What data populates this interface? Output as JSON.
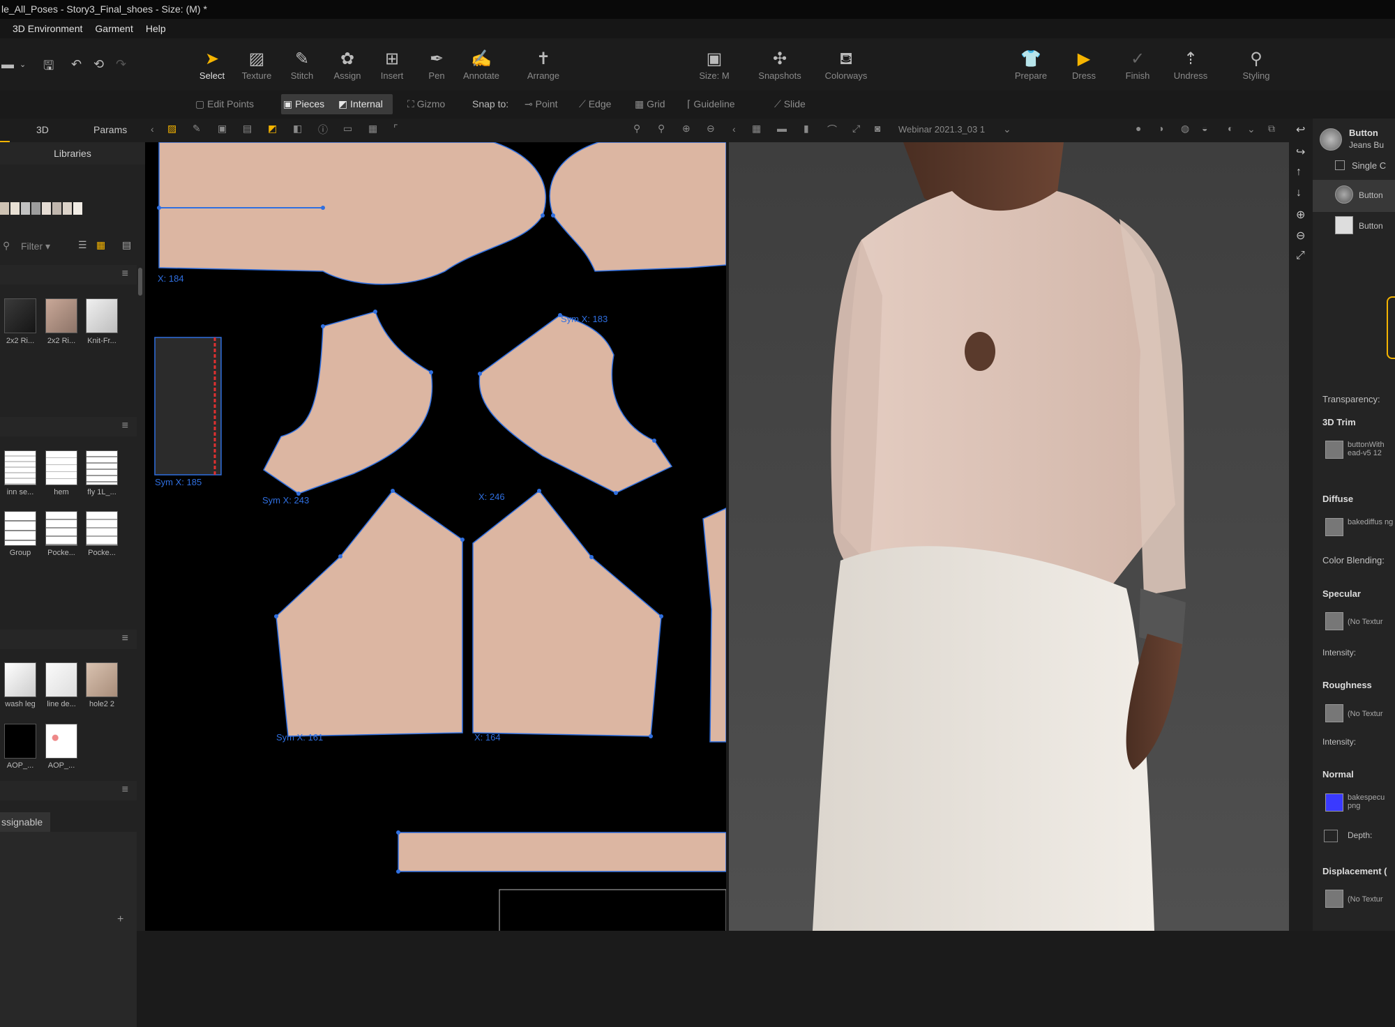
{
  "window": {
    "title": "le_All_Poses - Story3_Final_shoes - Size: (M) *"
  },
  "menu": [
    "3D Environment",
    "Garment",
    "Help"
  ],
  "toolbar": {
    "tools": [
      {
        "label": "Select",
        "icon": "arrow-select-icon",
        "glyph": "➤",
        "active": true
      },
      {
        "label": "Texture",
        "icon": "texture-icon",
        "glyph": "▨"
      },
      {
        "label": "Stitch",
        "icon": "stitch-icon",
        "glyph": "✎"
      },
      {
        "label": "Assign",
        "icon": "assign-icon",
        "glyph": "✿"
      },
      {
        "label": "Insert",
        "icon": "insert-icon",
        "glyph": "⊞"
      },
      {
        "label": "Pen",
        "icon": "pen-icon",
        "glyph": "✒"
      },
      {
        "label": "Annotate",
        "icon": "annotate-icon",
        "glyph": "✍"
      },
      {
        "label": "Arrange",
        "icon": "arrange-icon",
        "glyph": "✝"
      }
    ],
    "mid_tools": [
      {
        "label": "Size: M",
        "icon": "size-icon",
        "glyph": "▣"
      },
      {
        "label": "Snapshots",
        "icon": "snapshots-icon",
        "glyph": "✣"
      },
      {
        "label": "Colorways",
        "icon": "colorways-icon",
        "glyph": "⛾"
      }
    ],
    "right_tools": [
      {
        "label": "Prepare",
        "icon": "shirt-icon",
        "glyph": "👕"
      },
      {
        "label": "Dress",
        "icon": "play-icon",
        "glyph": "▶",
        "highlight": true
      },
      {
        "label": "Finish",
        "icon": "check-icon",
        "glyph": "✓"
      },
      {
        "label": "Undress",
        "icon": "undress-icon",
        "glyph": "⇡"
      },
      {
        "label": "Styling",
        "icon": "wand-icon",
        "glyph": "⚲"
      }
    ]
  },
  "subtoolbar": {
    "edit_points": "Edit Points",
    "pieces": "Pieces",
    "internal": "Internal",
    "gizmo": "Gizmo",
    "snap_to": "Snap to:",
    "point": "Point",
    "edge": "Edge",
    "grid": "Grid",
    "guideline": "Guideline",
    "slide": "Slide"
  },
  "sidebar": {
    "tabs": [
      "3D",
      "Params"
    ],
    "libraries": "Libraries",
    "filter": "Filter",
    "group1": [
      "2x2 Ri...",
      "2x2 Ri...",
      "Knit-Fr..."
    ],
    "group2": [
      "inn se...",
      "hem",
      "fly 1L_...",
      "Group",
      "Pocke...",
      "Pocke..."
    ],
    "group3": [
      "wash leg",
      "line de...",
      "hole2 2",
      "AOP_...",
      "AOP_..."
    ],
    "assignable": "ssignable",
    "add": "+"
  },
  "canvas2d": {
    "labels": [
      "X: 184",
      "Sym X: 183",
      "Sym X: 185",
      "Sym X: 243",
      "X: 246",
      "Sym X: 161",
      "X: 164"
    ],
    "piece_color": "#dcb6a2",
    "line_color": "#2f6fe0"
  },
  "viewbar": {
    "camera": "Webinar 2021.3_03 1"
  },
  "right_panel": {
    "header_title": "Button",
    "header_sub": "Jeans Bu",
    "single": "Single C",
    "item1": "Button",
    "item2": "Button",
    "transparency": "Transparency:",
    "trim_3d": "3D Trim",
    "trim_file": "buttonWith ead-v5 12",
    "diffuse": "Diffuse",
    "diffuse_file": "bakediffus ng",
    "color_blending": "Color Blending:",
    "specular": "Specular",
    "no_texture": "(No Textur",
    "intensity": "Intensity:",
    "roughness": "Roughness",
    "normal": "Normal",
    "normal_file": "bakespecu png",
    "depth": "Depth:",
    "displacement": "Displacement ("
  }
}
